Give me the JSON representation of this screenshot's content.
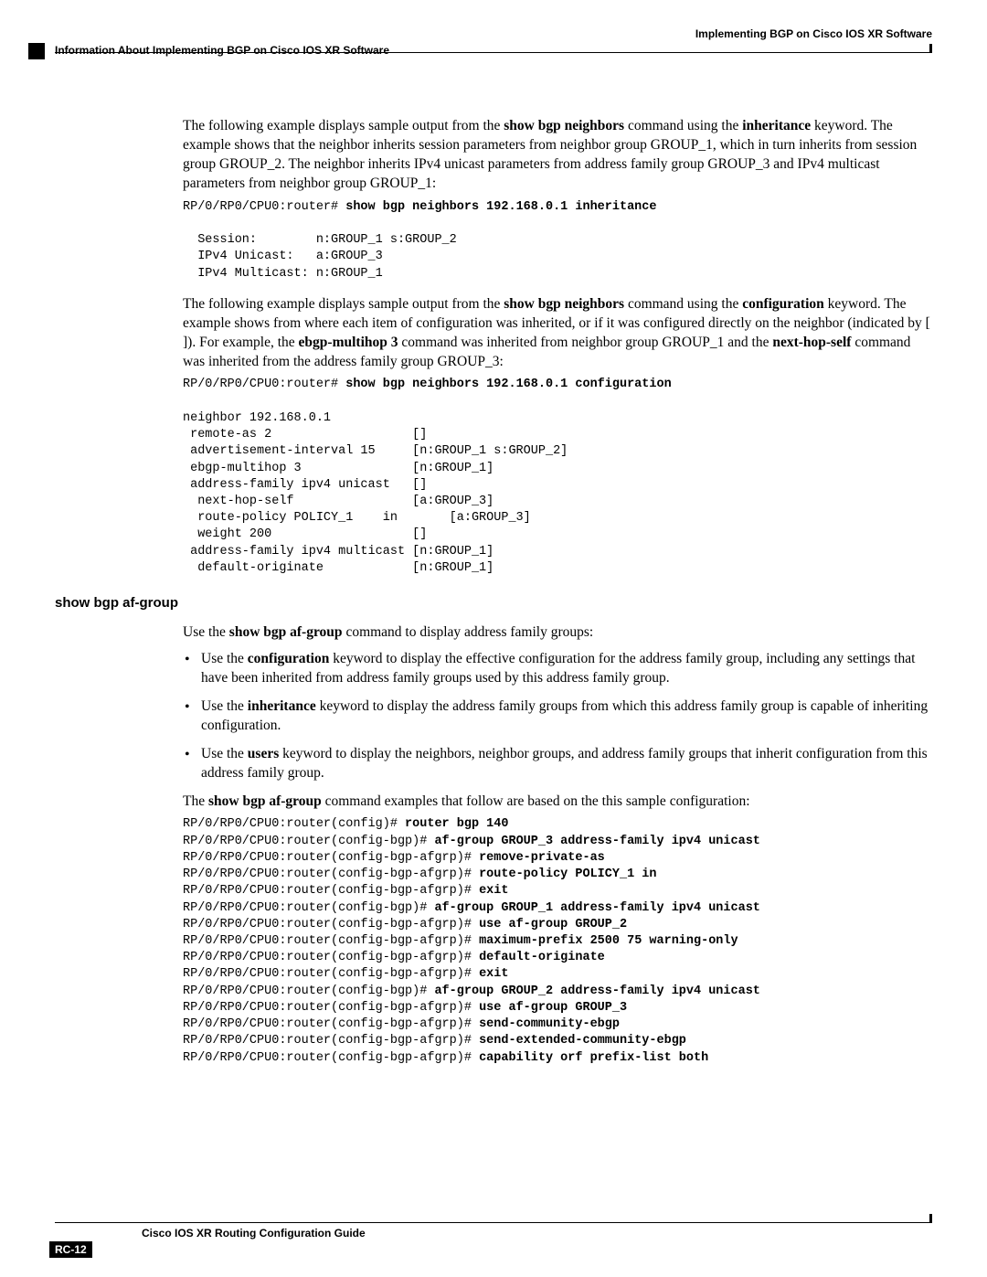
{
  "header": {
    "right": "Implementing BGP on Cisco IOS XR Software",
    "left": "Information About Implementing BGP on Cisco IOS XR Software"
  },
  "p1": {
    "t1": "The following example displays sample output from the ",
    "b1": "show bgp neighbors",
    "t2": " command using the ",
    "b2": "inheritance",
    "t3": " keyword. The example shows that the neighbor inherits session parameters from neighbor group GROUP_1, which in turn inherits from session group GROUP_2. The neighbor inherits IPv4 unicast parameters from address family group GROUP_3 and IPv4 multicast parameters from neighbor group GROUP_1:"
  },
  "code1": {
    "prompt": "RP/0/RP0/CPU0:router# ",
    "cmd": "show bgp neighbors 192.168.0.1 inheritance",
    "body": "  Session:        n:GROUP_1 s:GROUP_2\n  IPv4 Unicast:   a:GROUP_3\n  IPv4 Multicast: n:GROUP_1"
  },
  "p2": {
    "t1": "The following example displays sample output from the ",
    "b1": "show bgp neighbors",
    "t2": " command using the ",
    "b2": "configuration",
    "t3": " keyword. The example shows from where each item of configuration was inherited, or if it was configured directly on the neighbor (indicated by [ ]). For example, the ",
    "b3": "ebgp-multihop 3",
    "t4": " command was inherited from neighbor group GROUP_1 and the ",
    "b4": "next-hop-self",
    "t5": " command was inherited from the address family group GROUP_3:"
  },
  "code2": {
    "prompt": "RP/0/RP0/CPU0:router# ",
    "cmd": "show bgp neighbors 192.168.0.1 configuration",
    "body": "neighbor 192.168.0.1\n remote-as 2                   []\n advertisement-interval 15     [n:GROUP_1 s:GROUP_2]\n ebgp-multihop 3               [n:GROUP_1]\n address-family ipv4 unicast   []\n  next-hop-self                [a:GROUP_3]\n  route-policy POLICY_1    in       [a:GROUP_3]\n  weight 200                   []\n address-family ipv4 multicast [n:GROUP_1]\n  default-originate            [n:GROUP_1]"
  },
  "section_heading": "show bgp af-group",
  "p3": {
    "t1": "Use the ",
    "b1": "show bgp af-group",
    "t2": " command to display address family groups:"
  },
  "bullets": [
    {
      "t1": "Use the ",
      "b1": "configuration",
      "t2": " keyword to display the effective configuration for the address family group, including any settings that have been inherited from address family groups used by this address family group."
    },
    {
      "t1": "Use the ",
      "b1": "inheritance",
      "t2": " keyword to display the address family groups from which this address family group is capable of inheriting configuration."
    },
    {
      "t1": "Use the ",
      "b1": "users",
      "t2": " keyword to display the neighbors, neighbor groups, and address family groups that inherit configuration from this address family group."
    }
  ],
  "p4": {
    "t1": "The ",
    "b1": "show bgp af-group",
    "t2": " command examples that follow are based on the this sample configuration:"
  },
  "code3": [
    {
      "p": "RP/0/RP0/CPU0:router(config)# ",
      "c": "router bgp 140"
    },
    {
      "p": "RP/0/RP0/CPU0:router(config-bgp)# ",
      "c": "af-group GROUP_3 address-family ipv4 unicast"
    },
    {
      "p": "RP/0/RP0/CPU0:router(config-bgp-afgrp)# ",
      "c": "remove-private-as"
    },
    {
      "p": "RP/0/RP0/CPU0:router(config-bgp-afgrp)# ",
      "c": "route-policy POLICY_1 in"
    },
    {
      "p": "RP/0/RP0/CPU0:router(config-bgp-afgrp)# ",
      "c": "exit"
    },
    {
      "p": "RP/0/RP0/CPU0:router(config-bgp)# ",
      "c": "af-group GROUP_1 address-family ipv4 unicast"
    },
    {
      "p": "RP/0/RP0/CPU0:router(config-bgp-afgrp)# ",
      "c": "use af-group GROUP_2"
    },
    {
      "p": "RP/0/RP0/CPU0:router(config-bgp-afgrp)# ",
      "c": "maximum-prefix 2500 75 warning-only"
    },
    {
      "p": "RP/0/RP0/CPU0:router(config-bgp-afgrp)# ",
      "c": "default-originate"
    },
    {
      "p": "RP/0/RP0/CPU0:router(config-bgp-afgrp)# ",
      "c": "exit"
    },
    {
      "p": "RP/0/RP0/CPU0:router(config-bgp)# ",
      "c": "af-group GROUP_2 address-family ipv4 unicast"
    },
    {
      "p": "RP/0/RP0/CPU0:router(config-bgp-afgrp)# ",
      "c": "use af-group GROUP_3"
    },
    {
      "p": "RP/0/RP0/CPU0:router(config-bgp-afgrp)# ",
      "c": "send-community-ebgp"
    },
    {
      "p": "RP/0/RP0/CPU0:router(config-bgp-afgrp)# ",
      "c": "send-extended-community-ebgp"
    },
    {
      "p": "RP/0/RP0/CPU0:router(config-bgp-afgrp)# ",
      "c": "capability orf prefix-list both"
    }
  ],
  "footer": {
    "title": "Cisco IOS XR Routing Configuration Guide",
    "page": "RC-12"
  }
}
